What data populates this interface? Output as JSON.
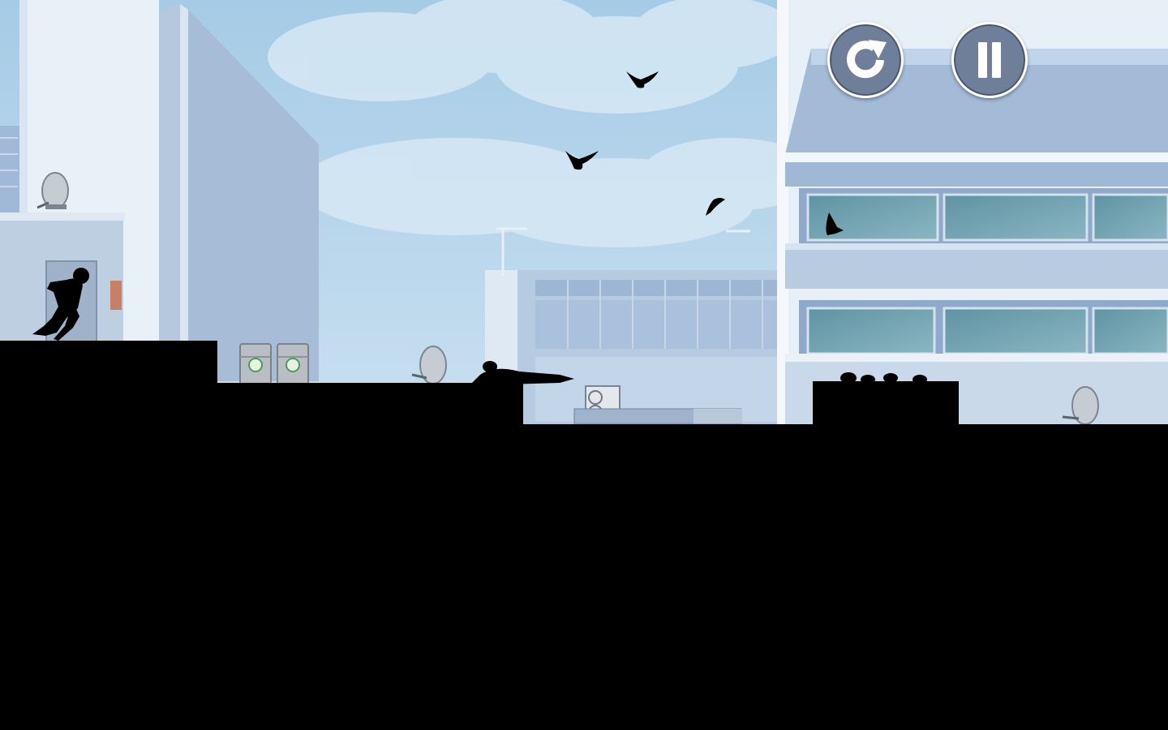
{
  "game": {
    "hud": {
      "restart_icon": "restart-icon",
      "pause_icon": "pause-icon"
    },
    "colors": {
      "sky": "#a9cfe8",
      "cloud": "#cfe3f2",
      "building_light": "#e8f0f8",
      "building_mid": "#b9cce2",
      "building_dark": "#8fa6c4",
      "window_glass": "#6fa0ad",
      "silhouette": "#000000",
      "hud_button": "#6f7f99"
    }
  }
}
